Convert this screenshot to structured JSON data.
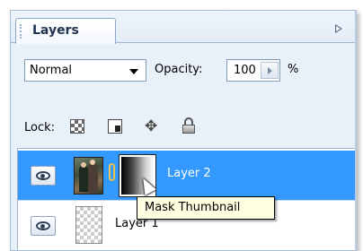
{
  "panel": {
    "tab_label": "Layers",
    "menu_icon": "panel-menu-arrow-icon"
  },
  "blend": {
    "mode": "Normal",
    "opacity_label": "Opacity:",
    "opacity_value": "100",
    "percent": "%"
  },
  "lock": {
    "label": "Lock:",
    "icons": [
      "lock-transparency-icon",
      "lock-pixels-icon",
      "lock-position-icon",
      "lock-all-icon"
    ]
  },
  "layers": [
    {
      "name": "Layer 2",
      "selected": true,
      "visible": true,
      "has_mask": true
    },
    {
      "name": "Layer 1",
      "selected": false,
      "visible": true,
      "has_mask": false
    }
  ],
  "tooltip": {
    "text": "Mask Thumbnail"
  },
  "colors": {
    "selection": "#3399ff",
    "panel_bg": "#e8f0f9",
    "tooltip_bg": "#ffffe1"
  }
}
